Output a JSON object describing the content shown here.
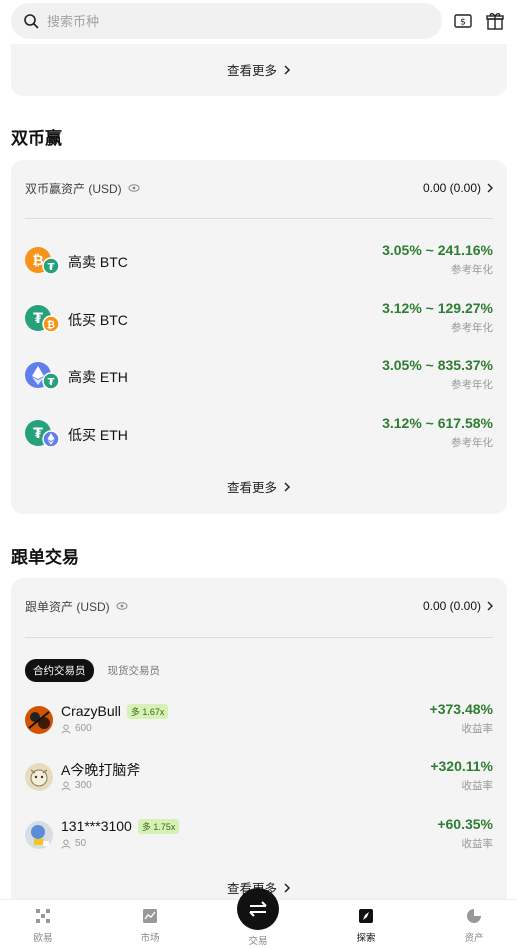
{
  "search": {
    "placeholder": "搜索币种"
  },
  "top_more": "查看更多",
  "dual": {
    "title": "双币赢",
    "asset_label": "双币赢资产 (USD)",
    "asset_value": "0.00 (0.00)",
    "products": [
      {
        "name": "高卖 BTC",
        "rate": "3.05% ~ 241.16%",
        "sub": "参考年化"
      },
      {
        "name": "低买 BTC",
        "rate": "3.12% ~ 129.27%",
        "sub": "参考年化"
      },
      {
        "name": "高卖 ETH",
        "rate": "3.05% ~ 835.37%",
        "sub": "参考年化"
      },
      {
        "name": "低买 ETH",
        "rate": "3.12% ~ 617.58%",
        "sub": "参考年化"
      }
    ],
    "more": "查看更多"
  },
  "copy": {
    "title": "跟单交易",
    "asset_label": "跟单资产 (USD)",
    "asset_value": "0.00 (0.00)",
    "tabs": {
      "active": "合约交易员",
      "other": "现货交易员"
    },
    "traders": [
      {
        "name": "CrazyBull",
        "lev": "多 1.67x",
        "followers": "600",
        "rate": "+373.48%",
        "sub": "收益率"
      },
      {
        "name": "A今晚打脑斧",
        "lev": "",
        "followers": "300",
        "rate": "+320.11%",
        "sub": "收益率"
      },
      {
        "name": "131***3100",
        "lev": "多 1.75x",
        "followers": "50",
        "rate": "+60.35%",
        "sub": "收益率"
      }
    ],
    "more": "查看更多"
  },
  "nav": {
    "items": [
      {
        "label": "欧易",
        "icon": "okx-logo-icon"
      },
      {
        "label": "市场",
        "icon": "market-chart-icon"
      },
      {
        "label": "交易",
        "icon": "trade-swap-icon"
      },
      {
        "label": "探索",
        "icon": "explore-compass-icon"
      },
      {
        "label": "资产",
        "icon": "assets-pie-icon"
      }
    ]
  },
  "colors": {
    "positive": "#2e7d32",
    "card_bg": "#f4f4f4",
    "leverage_bg": "#d6f0b8"
  }
}
